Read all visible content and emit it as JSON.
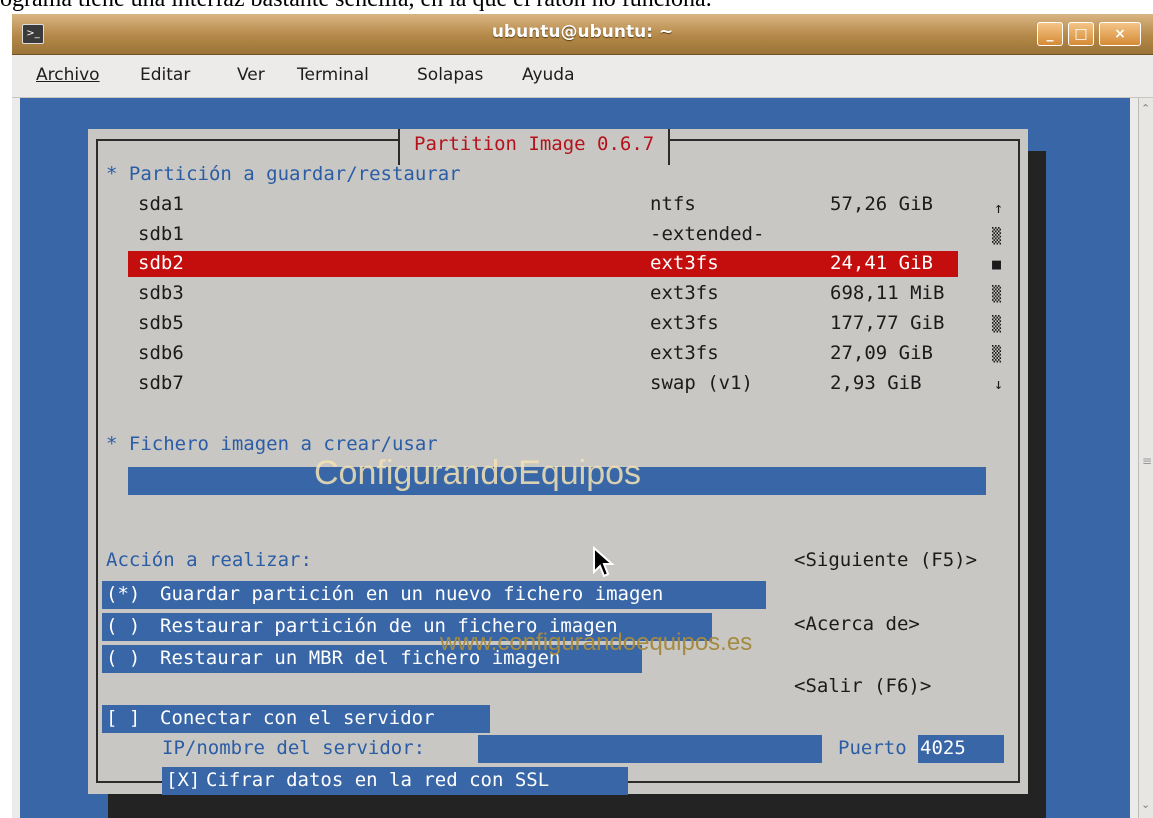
{
  "caption": "ograma tiene una interfaz bastante sencilla, en la que el ratón no funciona.",
  "window": {
    "title": "ubuntu@ubuntu: ~",
    "buttons": {
      "minimize": "_",
      "maximize": "□",
      "close": "×"
    }
  },
  "menubar": [
    {
      "label": "Archivo"
    },
    {
      "label": "Editar"
    },
    {
      "label": "Ver"
    },
    {
      "label": "Terminal"
    },
    {
      "label": "Solapas"
    },
    {
      "label": "Ayuda"
    }
  ],
  "dialog": {
    "title": "Partition Image 0.6.7",
    "partition_label": "* Partición a guardar/restaurar",
    "partitions": [
      {
        "name": "sda1",
        "fs": "ntfs",
        "size": "57,26 GiB"
      },
      {
        "name": "sdb1",
        "fs": "-extended-",
        "size": ""
      },
      {
        "name": "sdb2",
        "fs": "ext3fs",
        "size": "24,41 GiB",
        "selected": true
      },
      {
        "name": "sdb3",
        "fs": "ext3fs",
        "size": "698,11 MiB"
      },
      {
        "name": "sdb5",
        "fs": "ext3fs",
        "size": "177,77 GiB"
      },
      {
        "name": "sdb6",
        "fs": "ext3fs",
        "size": "27,09 GiB"
      },
      {
        "name": "sdb7",
        "fs": "swap (v1)",
        "size": "2,93 GiB"
      }
    ],
    "list_scroll": {
      "up": "↑",
      "track": "▒",
      "thumb": "■",
      "down": "↓"
    },
    "image_file_label": "* Fichero imagen a crear/usar",
    "image_file_value": "",
    "action_label": "Acción a realizar:",
    "actions": [
      {
        "marker": "(*)",
        "label": "Guardar partición en un nuevo fichero imagen"
      },
      {
        "marker": "( )",
        "label": "Restaurar partición de un fichero imagen"
      },
      {
        "marker": "( )",
        "label": "Restaurar un MBR del fichero imagen"
      }
    ],
    "buttons": {
      "next": "<Siguiente (F5)>",
      "about": "<Acerca de>",
      "exit": "<Salir (F6)>"
    },
    "connect": {
      "marker": "[ ]",
      "label": "Conectar con el servidor"
    },
    "server_label": "IP/nombre del servidor:",
    "server_value": "",
    "port_label": "Puerto",
    "port_value": "4025",
    "ssl": {
      "marker": "[X]",
      "label": "Cifrar datos en la red con SSL"
    }
  },
  "watermarks": {
    "brand": "ConfigurandoEquipos",
    "url": "www.configurandoequipos.es"
  },
  "colors": {
    "terminal_bg": "#3866a7",
    "dialog_bg": "#c8c7c3",
    "highlight": "#c40d0d",
    "title_red": "#b5121b"
  }
}
